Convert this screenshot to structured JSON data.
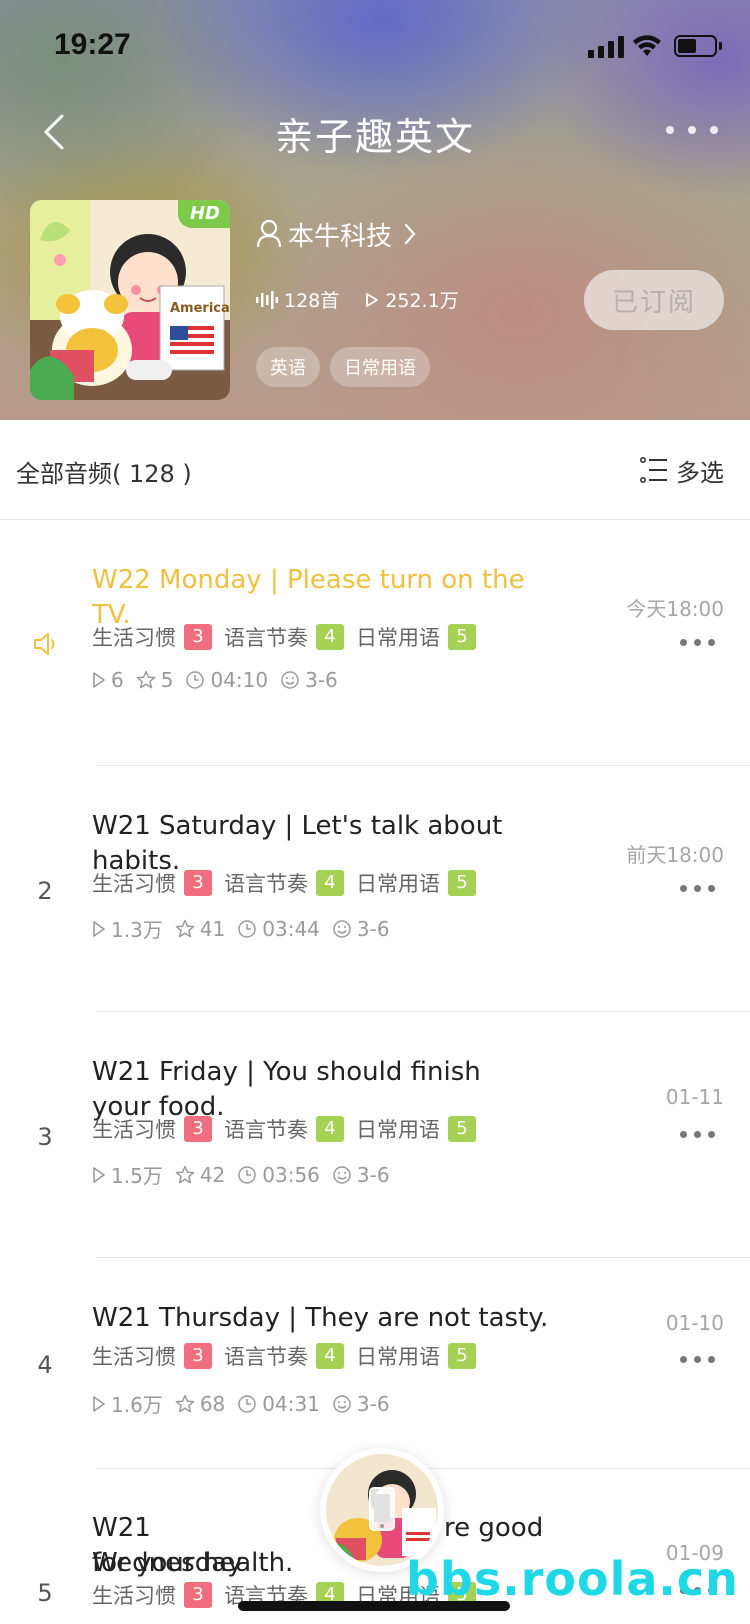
{
  "status_bar": {
    "time": "19:27"
  },
  "nav": {
    "title": "亲子趣英文"
  },
  "album": {
    "hd_badge": "HD",
    "author": "本牛科技",
    "track_count": "128首",
    "play_count": "252.1万",
    "subscribe_label": "已订阅",
    "tags": [
      "英语",
      "日常用语"
    ]
  },
  "list_header": {
    "count_label": "全部音频( 128 )",
    "multiselect_label": "多选"
  },
  "episodes": [
    {
      "index": "",
      "playing": true,
      "title": "W22 Monday | Please turn on the TV.",
      "date": "今天18:00",
      "tags": [
        {
          "label": "生活习惯",
          "level": "3"
        },
        {
          "label": "语言节奏",
          "level": "4"
        },
        {
          "label": "日常用语",
          "level": "5"
        }
      ],
      "plays": "6",
      "favs": "5",
      "duration": "04:10",
      "age": "3-6"
    },
    {
      "index": "2",
      "playing": false,
      "title": "W21 Saturday | Let's talk about habits.",
      "date": "前天18:00",
      "tags": [
        {
          "label": "生活习惯",
          "level": "3"
        },
        {
          "label": "语言节奏",
          "level": "4"
        },
        {
          "label": "日常用语",
          "level": "5"
        }
      ],
      "plays": "1.3万",
      "favs": "41",
      "duration": "03:44",
      "age": "3-6"
    },
    {
      "index": "3",
      "playing": false,
      "title": "W21 Friday | You should finish your food.",
      "date": "01-11",
      "tags": [
        {
          "label": "生活习惯",
          "level": "3"
        },
        {
          "label": "语言节奏",
          "level": "4"
        },
        {
          "label": "日常用语",
          "level": "5"
        }
      ],
      "plays": "1.5万",
      "favs": "42",
      "duration": "03:56",
      "age": "3-6"
    },
    {
      "index": "4",
      "playing": false,
      "title": "W21 Thursday | They are not tasty.",
      "date": "01-10",
      "tags": [
        {
          "label": "生活习惯",
          "level": "3"
        },
        {
          "label": "语言节奏",
          "level": "4"
        },
        {
          "label": "日常用语",
          "level": "5"
        }
      ],
      "plays": "1.6万",
      "favs": "68",
      "duration": "04:31",
      "age": "3-6"
    },
    {
      "index": "5",
      "playing": false,
      "title": "W21 Wednesday",
      "title_tail": "re good",
      "title_line2": "for your health.",
      "date": "01-09",
      "tags": [
        {
          "label": "生活习惯",
          "level": "3"
        },
        {
          "label": "语言节奏",
          "level": "4"
        },
        {
          "label": "日常用语",
          "level": "5"
        }
      ]
    }
  ],
  "watermark": "bbs.roola.cn",
  "colors": {
    "accent_playing": "#f0c040",
    "level_red": "#f06e7e",
    "level_green": "#a5d254",
    "hd_green": "#7dc94a",
    "watermark": "#1fd7e7"
  }
}
